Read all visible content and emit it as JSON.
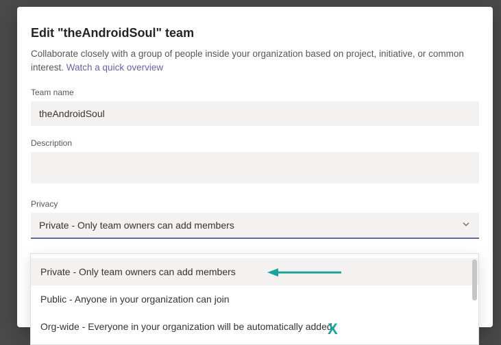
{
  "dialog": {
    "title": "Edit \"theAndroidSoul\" team",
    "description_prefix": "Collaborate closely with a group of people inside your organization based on project, initiative, or common interest. ",
    "overview_link": "Watch a quick overview"
  },
  "fields": {
    "team_name_label": "Team name",
    "team_name_value": "theAndroidSoul",
    "description_label": "Description",
    "description_value": "",
    "privacy_label": "Privacy",
    "privacy_value": "Private - Only team owners can add members"
  },
  "privacy_options": [
    "Private - Only team owners can add members",
    "Public - Anyone in your organization can join",
    "Org-wide - Everyone in your organization will be automatically added"
  ],
  "annotations": {
    "x_mark": "X"
  },
  "colors": {
    "accent": "#6264a7",
    "annotation": "#1aa39a"
  }
}
